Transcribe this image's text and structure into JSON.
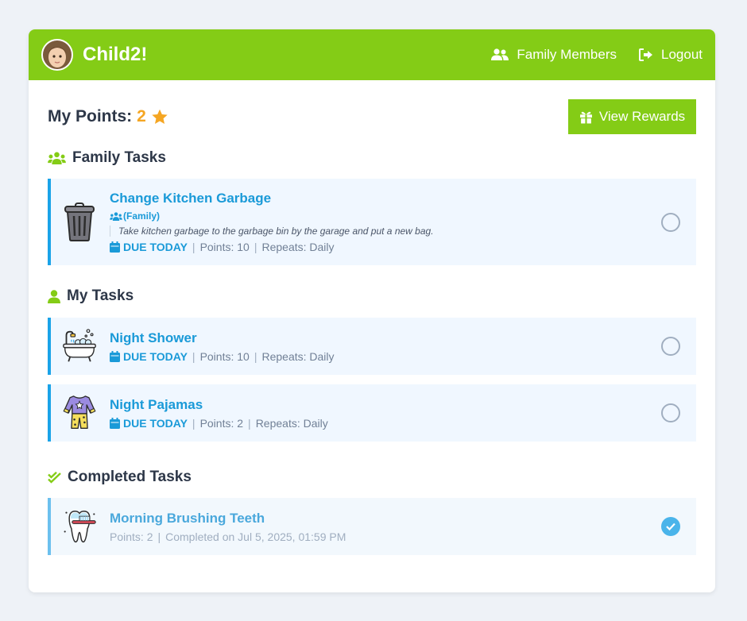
{
  "header": {
    "user_name": "Child2!",
    "nav_family_members": "Family Members",
    "nav_logout": "Logout"
  },
  "points": {
    "label": "My Points:",
    "value": "2"
  },
  "rewards_button": "View Rewards",
  "sections": {
    "family": {
      "title": "Family Tasks",
      "tasks": [
        {
          "title": "Change Kitchen Garbage",
          "tag": "(Family)",
          "description": "Take kitchen garbage to the garbage bin by the garage and put a new bag.",
          "due": "DUE TODAY",
          "points": "Points: 10",
          "repeats": "Repeats: Daily",
          "icon": "trash-can-icon"
        }
      ]
    },
    "mine": {
      "title": "My Tasks",
      "tasks": [
        {
          "title": "Night Shower",
          "due": "DUE TODAY",
          "points": "Points: 10",
          "repeats": "Repeats: Daily",
          "icon": "bathtub-icon"
        },
        {
          "title": "Night Pajamas",
          "due": "DUE TODAY",
          "points": "Points: 2",
          "repeats": "Repeats: Daily",
          "icon": "pajamas-icon"
        }
      ]
    },
    "completed": {
      "title": "Completed Tasks",
      "tasks": [
        {
          "title": "Morning Brushing Teeth",
          "points": "Points: 2",
          "completed": "Completed on Jul 5, 2025, 01:59 PM",
          "icon": "tooth-icon"
        }
      ]
    }
  },
  "colors": {
    "brand_green": "#84cc16",
    "accent_blue": "#1a9ad8",
    "star_gold": "#f5a623"
  }
}
